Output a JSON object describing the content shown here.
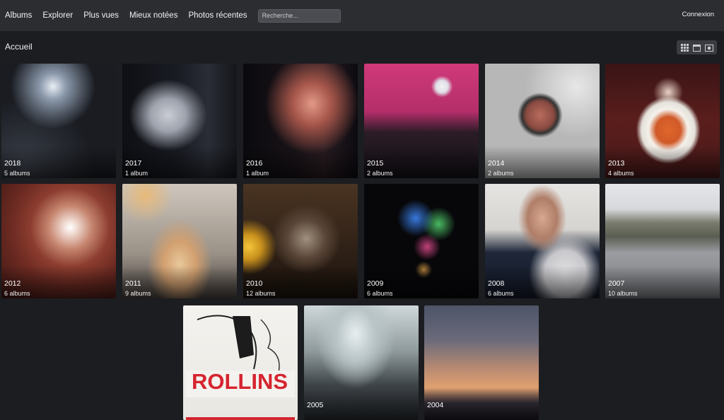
{
  "nav": {
    "items": [
      "Albums",
      "Explorer",
      "Plus vues",
      "Mieux notées",
      "Photos récentes"
    ],
    "search_placeholder": "Recherche...",
    "login": "Connexion"
  },
  "breadcrumb": "Accueil",
  "view_icons": [
    "grid-icon",
    "calendar-icon",
    "photo-icon"
  ],
  "albums": [
    {
      "year": "2018",
      "count": "5 albums"
    },
    {
      "year": "2017",
      "count": "1 album"
    },
    {
      "year": "2016",
      "count": "1 album"
    },
    {
      "year": "2015",
      "count": "2 albums"
    },
    {
      "year": "2014",
      "count": "2 albums"
    },
    {
      "year": "2013",
      "count": "4 albums"
    },
    {
      "year": "2012",
      "count": "6 albums"
    },
    {
      "year": "2011",
      "count": "9 albums"
    },
    {
      "year": "2010",
      "count": "12 albums"
    },
    {
      "year": "2009",
      "count": "6 albums"
    },
    {
      "year": "2008",
      "count": "6 albums"
    },
    {
      "year": "2007",
      "count": "10 albums"
    },
    {
      "year": "",
      "count": ""
    },
    {
      "year": "2005",
      "count": ""
    },
    {
      "year": "2004",
      "count": ""
    }
  ]
}
